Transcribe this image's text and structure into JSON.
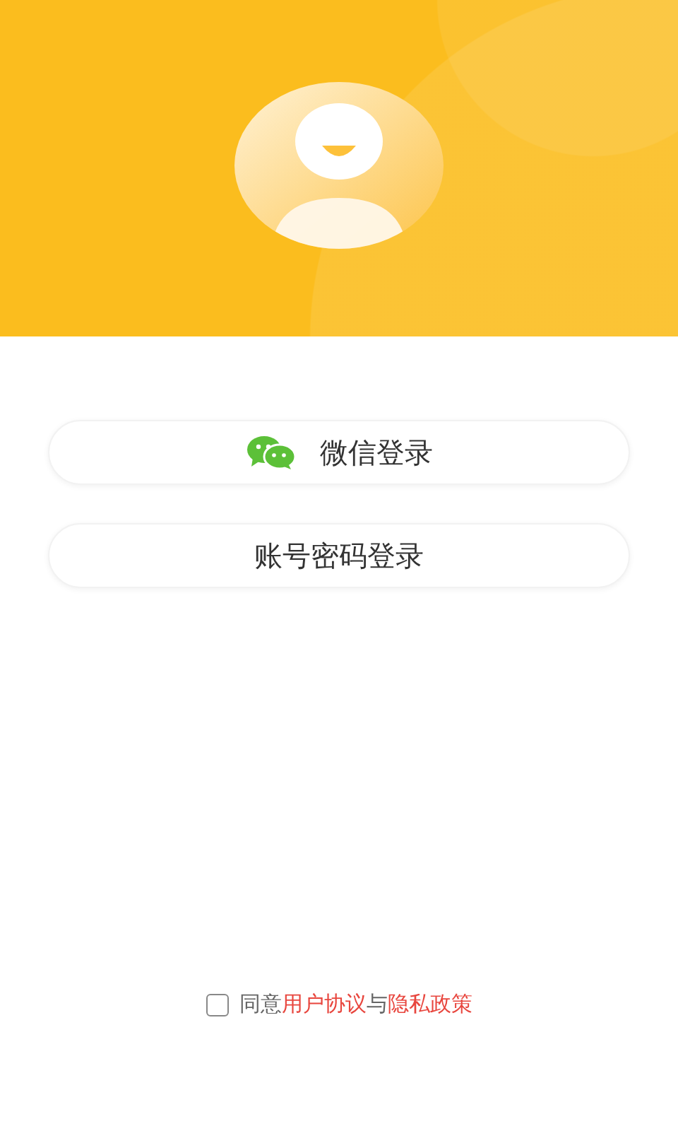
{
  "buttons": [
    {
      "kind": "wechat",
      "label": "微信登录"
    },
    {
      "kind": "plain",
      "label": "账号密码登录"
    }
  ],
  "agreement": {
    "checked": false,
    "parts": [
      {
        "kind": "text",
        "text": "同意"
      },
      {
        "kind": "link",
        "text": "用户协议"
      },
      {
        "kind": "text",
        "text": "与"
      },
      {
        "kind": "link",
        "text": "隐私政策"
      }
    ]
  }
}
